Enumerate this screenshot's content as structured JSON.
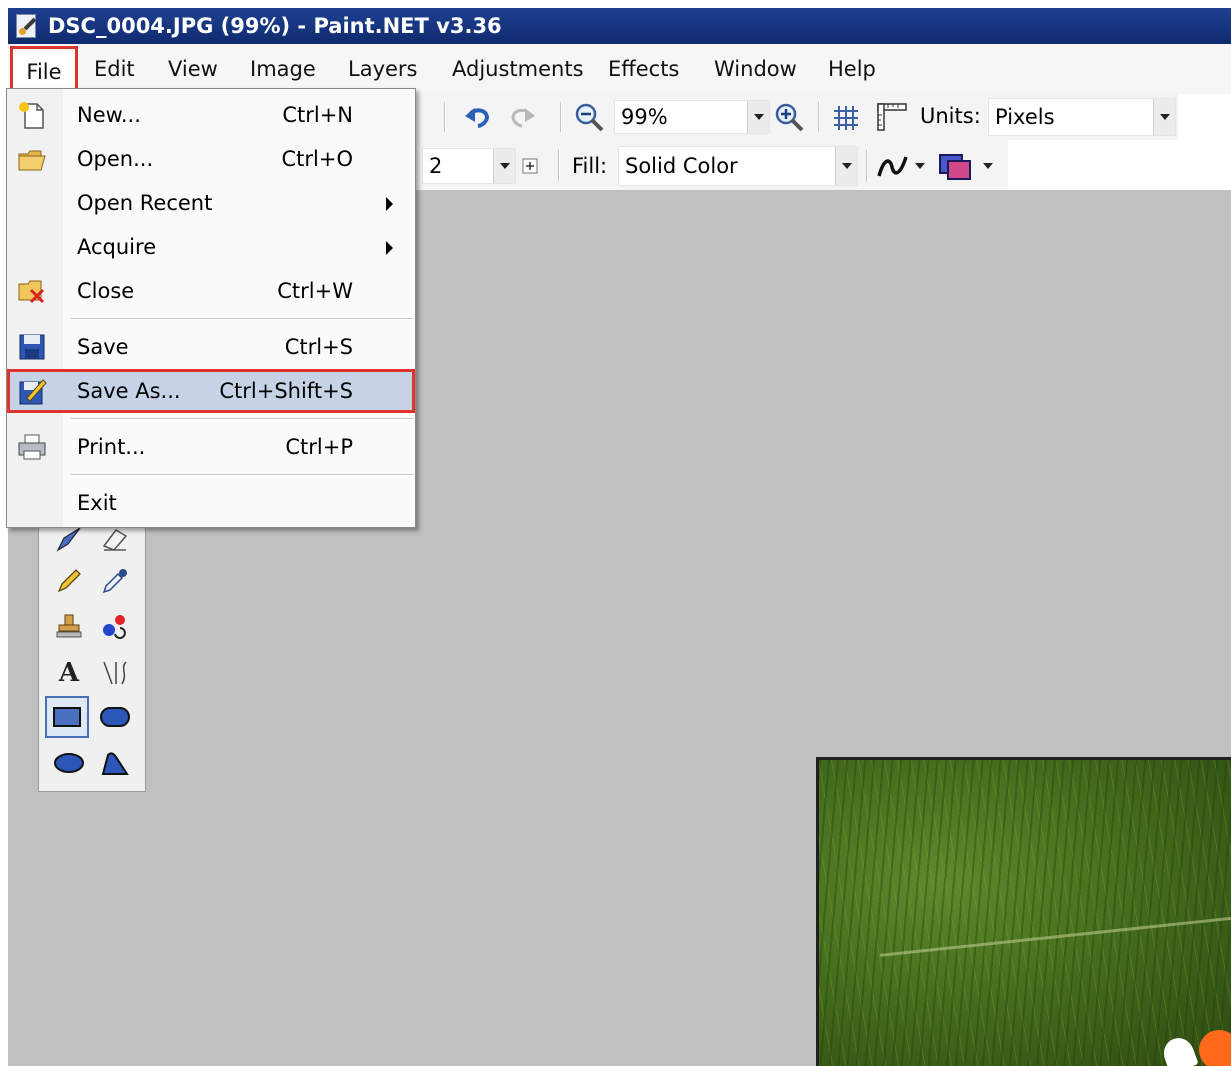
{
  "window": {
    "title": "DSC_0004.JPG (99%) - Paint.NET v3.36"
  },
  "menubar": {
    "items": [
      {
        "label": "File"
      },
      {
        "label": "Edit"
      },
      {
        "label": "View"
      },
      {
        "label": "Image"
      },
      {
        "label": "Layers"
      },
      {
        "label": "Adjustments"
      },
      {
        "label": "Effects"
      },
      {
        "label": "Window"
      },
      {
        "label": "Help"
      }
    ]
  },
  "toolbar": {
    "zoom_value": "99%",
    "units_label": "Units:",
    "units_value": "Pixels",
    "brush_width_value": "2",
    "fill_label": "Fill:",
    "fill_value": "Solid Color"
  },
  "file_menu": {
    "items": [
      {
        "label": "New...",
        "shortcut": "Ctrl+N"
      },
      {
        "label": "Open...",
        "shortcut": "Ctrl+O"
      },
      {
        "label": "Open Recent",
        "shortcut": ""
      },
      {
        "label": "Acquire",
        "shortcut": ""
      },
      {
        "label": "Close",
        "shortcut": "Ctrl+W"
      },
      {
        "label": "Save",
        "shortcut": "Ctrl+S"
      },
      {
        "label": "Save As...",
        "shortcut": "Ctrl+Shift+S"
      },
      {
        "label": "Print...",
        "shortcut": "Ctrl+P"
      },
      {
        "label": "Exit",
        "shortcut": ""
      }
    ]
  },
  "tools": {
    "text_tool_glyph": "A"
  },
  "colors": {
    "titlebar": "#16347e",
    "workspace": "#c0c0c0",
    "highlight": "#c6d2e6",
    "annotation_red": "#e0322f"
  }
}
